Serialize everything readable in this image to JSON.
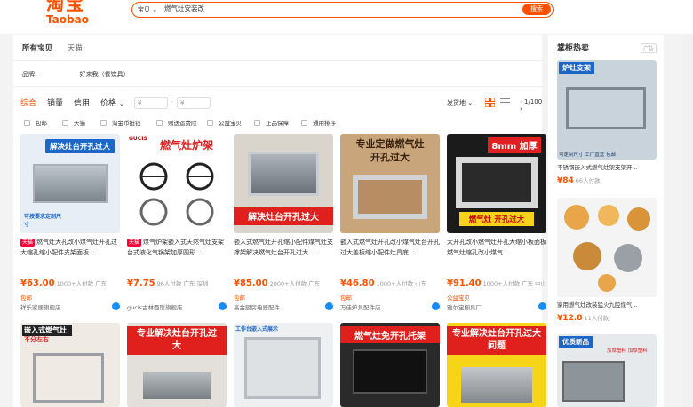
{
  "header": {
    "logo_cn": "淘宝",
    "logo_en": "Taobao",
    "search_type": "宝贝",
    "search_value": "燃气灶安装改",
    "search_button": "搜索"
  },
  "tabs": {
    "all": "所有宝贝",
    "tmall": "天猫"
  },
  "brand": {
    "label": "品牌:",
    "value": "好来我（餐饮具）"
  },
  "sort": {
    "comprehensive": "综合",
    "sales": "销量",
    "credit": "信用",
    "price": "价格",
    "price_min_placeholder": "¥",
    "price_max_placeholder": "¥",
    "ship_from": "发货地",
    "page": "1/100"
  },
  "filters": [
    "包邮",
    "天猫",
    "淘金币抵钱",
    "赠送运费险",
    "公益宝贝",
    "正品保障",
    "通用排序"
  ],
  "products": [
    {
      "image_text": "解决灶台开孔过大",
      "image_sub": "可按要求定制尺寸",
      "badge": "天猫",
      "title_a": "燃气灶大孔改小煤气灶开孔过大缩孔缩小配件支架面板...",
      "price": "¥63.00",
      "sales": "1000+人付款",
      "loc": "广东",
      "shipping": "包邮",
      "shop": "祥乐家居旗舰店"
    },
    {
      "image_text": "燃气灶炉架",
      "image_sub": "GUCIS",
      "badge": "天猫",
      "title_a": "煤气炉架嵌入式天然气灶支架台式液化气锅架加厚圆形...",
      "price": "¥7.75",
      "sales": "96人付款",
      "loc": "广东 深圳",
      "shipping": "",
      "shop": "gucis古林西斯旗舰店"
    },
    {
      "image_text": "解决灶台开孔过大",
      "image_sub": "",
      "badge": "",
      "title_a": "嵌入式燃气灶开孔缩小配件煤气灶支撑架解决燃气灶台开孔过大...",
      "price": "¥85.00",
      "sales": "2000+人付款",
      "loc": "广东",
      "shipping": "包邮",
      "shop": "高金厨房电器配件"
    },
    {
      "image_text": "专业定做燃气灶开孔过大",
      "image_sub": "",
      "badge": "",
      "title_a": "嵌入式燃气灶开孔改小煤气灶台开孔过大盖板缩小配件灶具底...",
      "price": "¥46.80",
      "sales": "1000+人付款",
      "loc": "山东",
      "shipping": "包邮",
      "shop": "万佳炉具配件店"
    },
    {
      "image_text": "8mm 加厚",
      "image_sub": "燃气灶 开孔过大",
      "badge": "",
      "title_a": "大开孔改小燃气灶开孔大缩小板面板燃气灶缩孔改小煤气...",
      "price": "¥91.40",
      "sales": "1000+人付款",
      "loc": "广东 中山",
      "shipping": "公益宝贝",
      "shop": "雅尔宝橱具厂"
    }
  ],
  "row2": [
    {
      "image_text": "嵌入式燃气灶",
      "image_sub": "不分左右"
    },
    {
      "image_text": "专业解决灶台开孔过大",
      "image_sub": ""
    },
    {
      "image_text": "工作台嵌入式展示",
      "image_sub": ""
    },
    {
      "image_text": "燃气灶免开孔托架",
      "image_sub": ""
    },
    {
      "image_text": "专业解决灶台开孔过大问题",
      "image_sub": ""
    }
  ],
  "side": {
    "title": "掌柜热卖",
    "ad": "广告",
    "items": [
      {
        "image_text": "炉灶支架",
        "image_sub": "可定制尺寸 工厂直营 包邮",
        "title": "不锈钢嵌入式燃气灶架支架开...",
        "price": "¥84",
        "sales": "66人付款"
      },
      {
        "image_text": "",
        "image_sub": "",
        "title": "家用燃气灶改装猛火九腔煤气...",
        "price": "¥12.8",
        "sales": "11人付款"
      },
      {
        "image_text": "优质新品",
        "image_sub": "加厚塑料 加厚塑料",
        "title": "",
        "price": "",
        "sales": ""
      }
    ]
  }
}
